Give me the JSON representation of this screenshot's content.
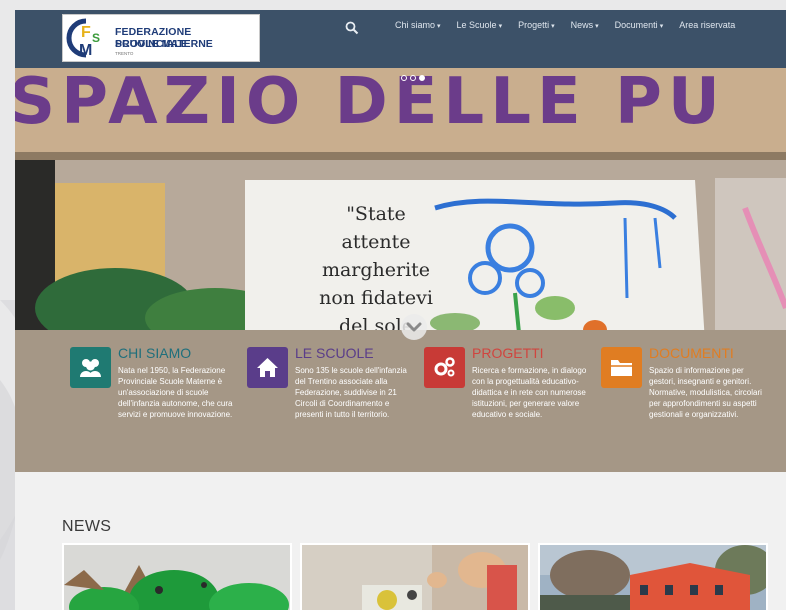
{
  "logo": {
    "line1": "FEDERAZIONE PROVINCIALE",
    "line2": "SCUOLE MATERNE",
    "line3": "TRENTO",
    "mark_letters": [
      "F",
      "S",
      "M"
    ]
  },
  "header": {
    "search_icon": "search-icon",
    "nav": [
      {
        "label": "Chi siamo",
        "has_dropdown": true
      },
      {
        "label": "Le Scuole",
        "has_dropdown": true
      },
      {
        "label": "Progetti",
        "has_dropdown": true
      },
      {
        "label": "News",
        "has_dropdown": true
      },
      {
        "label": "Documenti",
        "has_dropdown": true
      },
      {
        "label": "Area riservata",
        "has_dropdown": false
      }
    ]
  },
  "hero": {
    "banner_text": "SPAZIO DELLE PU",
    "handwriting": [
      "\"State",
      "attente",
      "margherite",
      "non fidatevi",
      "del sole"
    ],
    "slides_total": 3,
    "slide_active": 3,
    "scroll_icon": "chevron-down-icon"
  },
  "features": [
    {
      "title": "CHI SIAMO",
      "icon": "users-icon",
      "color": "#1f7a72",
      "title_color": "#1f6f7c",
      "desc": "Nata nel 1950, la Federazione Provinciale Scuole Materne è un'associazione di scuole dell'infanzia autonome, che cura servizi e promuove innovazione."
    },
    {
      "title": "LE SCUOLE",
      "icon": "home-icon",
      "color": "#5a3d8a",
      "title_color": "#5a3d8a",
      "desc": "Sono 135 le scuole dell'infanzia del Trentino associate alla Federazione, suddivise in 21 Circoli di Coordinamento e presenti in tutto il territorio."
    },
    {
      "title": "PROGETTI",
      "icon": "gears-icon",
      "color": "#c83a36",
      "title_color": "#d0453f",
      "desc": "Ricerca e formazione, in dialogo con la progettualità educativo-didattica e in rete con numerose istituzioni, per generare valore educativo e sociale."
    },
    {
      "title": "DOCUMENTI",
      "icon": "folder-icon",
      "color": "#e07d22",
      "title_color": "#e07d22",
      "desc": "Spazio di informazione per gestori, insegnanti e genitori. Normative, modulistica, circolari per approfondimenti su aspetti gestionali e organizzativi."
    }
  ],
  "news": {
    "title": "NEWS",
    "cards": [
      "news-card-garden",
      "news-card-robotics",
      "news-card-school-building"
    ]
  }
}
